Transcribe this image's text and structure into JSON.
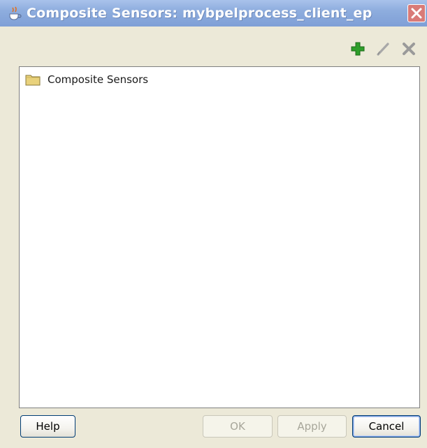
{
  "window": {
    "title": "Composite Sensors: mybpelprocess_client_ep"
  },
  "toolbar": {
    "add_icon": "plus-icon",
    "edit_icon": "pencil-icon",
    "delete_icon": "delete-x-icon"
  },
  "tree": {
    "root": {
      "label": "Composite Sensors",
      "icon": "folder-icon"
    }
  },
  "buttons": {
    "help": "Help",
    "ok": "OK",
    "apply": "Apply",
    "cancel": "Cancel"
  },
  "colors": {
    "titlebar": "#8eadde",
    "close_button": "#d97b78",
    "add_icon": "#2e9e2a",
    "folder": "#e9d27c"
  }
}
